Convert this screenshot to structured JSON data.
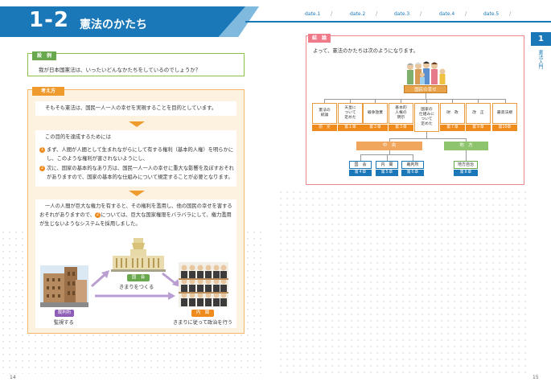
{
  "header": {
    "number": "1-2",
    "title": "憲法のかたち",
    "dates": [
      "date.1",
      "date.2",
      "date.3",
      "date.4",
      "date.5"
    ],
    "slash": "/"
  },
  "side": {
    "tab": "1",
    "text": "憲法入門"
  },
  "question": {
    "label": "設　例",
    "text": "我が日本国憲法は、いったいどんなかたちをしているのでしょうか？"
  },
  "thinking": {
    "label": "考え方",
    "p1": "そもそも憲法は、国民一人一人の幸せを実現することを目的としています。",
    "p2_intro": "この目的を達成するためには",
    "p2_item1_num": "1",
    "p2_item1_a": "まず、人間が人間として生まれながらにして有する権利（基本的人権）を明らかに",
    "p2_item1_b": "し、このような権利が害されないようにし、",
    "p2_item2_num": "2",
    "p2_item2_a": "次に、国家の基本的なあり方は、国民一人一人の幸せに重大な影響を及ぼすおそれ",
    "p2_item2_b": "がありますので、国家の基本的な仕組みについて規定することが必要となります。",
    "p3_a": "一人の人間が巨大な権力を有すると、その権利を濫用し、他の国民の幸せを害する",
    "p3_b": "おそれがありますので、",
    "p3_num": "2",
    "p3_c": "については、巨大な国家権限をバラバラにして、権力濫用",
    "p3_d": "が生じないようなシステムを採用しました。"
  },
  "illustration": {
    "court_label": "裁判所",
    "court_text": "監視する",
    "diet_label": "国　会",
    "diet_text": "きまりをつくる",
    "cabinet_label": "内　閣",
    "cabinet_text": "きまりに従って政治を行う"
  },
  "conclusion": {
    "label": "結　論",
    "text": "よって、憲法のかたちは次のようになります。",
    "happiness": "国民の幸せ",
    "boxes": [
      {
        "title": "憲法の\n総論",
        "tag": "前　文"
      },
      {
        "title": "天皇に\nついて\n定めた",
        "tag": "第１章"
      },
      {
        "title": "戦争放棄",
        "tag": "第２章"
      },
      {
        "title": "基本的\n人権の\n明示",
        "tag": "第３章"
      },
      {
        "title": "国家の\n仕組みに\nついて\n定めた",
        "tag": ""
      },
      {
        "title": "財　政",
        "tag": "第７章"
      },
      {
        "title": "改　正",
        "tag": "第９章"
      },
      {
        "title": "最高法規",
        "tag": "第10章"
      }
    ],
    "central": "中　央",
    "local": "地　方",
    "central_items": [
      {
        "name": "国　会",
        "tag": "第４章"
      },
      {
        "name": "内　閣",
        "tag": "第５章"
      },
      {
        "name": "裁判所",
        "tag": "第６章"
      }
    ],
    "local_item": {
      "name": "地方自治",
      "tag": "第８章"
    }
  },
  "pages": {
    "left": "14",
    "right": "15"
  },
  "colors": {
    "blue": "#1b78b8",
    "orange": "#ef8a1c",
    "green": "#6aa84f",
    "pink": "#ef7a8a"
  }
}
